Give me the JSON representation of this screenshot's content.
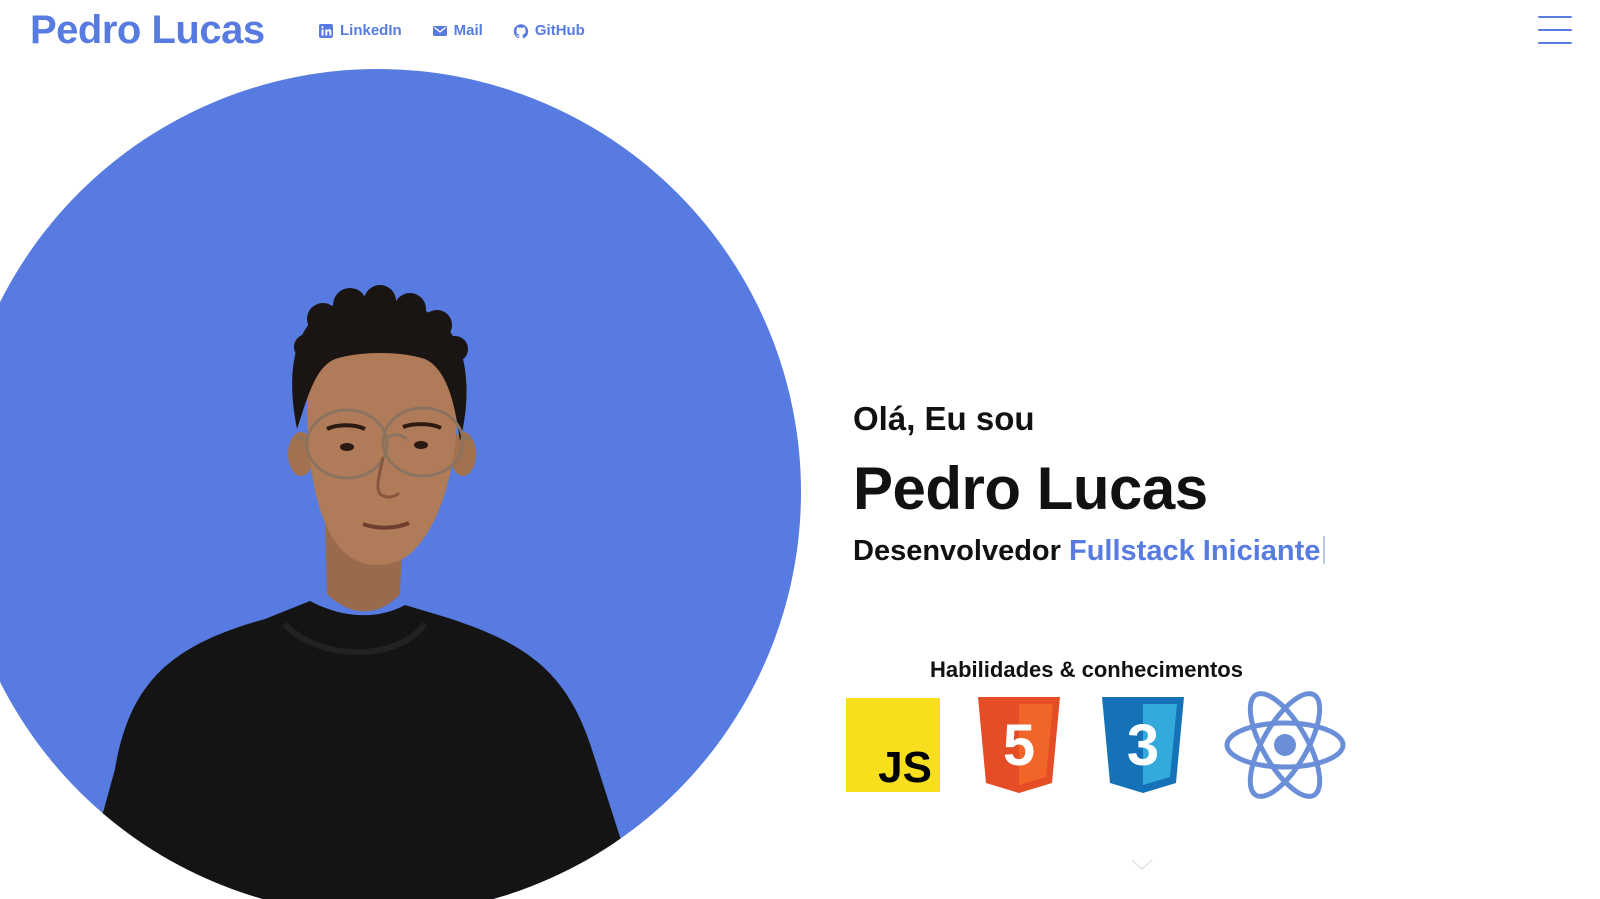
{
  "header": {
    "brand": "Pedro Lucas",
    "nav": [
      {
        "label": "LinkedIn",
        "icon": "linkedin-icon"
      },
      {
        "label": "Mail",
        "icon": "mail-icon"
      },
      {
        "label": "GitHub",
        "icon": "github-icon"
      }
    ],
    "menu_icon": "hamburger-menu-icon"
  },
  "hero": {
    "greeting": "Olá, Eu sou",
    "name": "Pedro Lucas",
    "role_prefix": "Desenvolvedor",
    "role_highlight": "Fullstack Iniciante",
    "photo_icon": "profile-photo"
  },
  "skills": {
    "title": "Habilidades & conhecimentos",
    "items": [
      {
        "name": "javascript-icon",
        "text": "JS"
      },
      {
        "name": "html5-icon",
        "text": "5"
      },
      {
        "name": "css3-icon",
        "text": "3"
      },
      {
        "name": "react-icon"
      }
    ]
  },
  "colors": {
    "accent": "#577be0",
    "text": "#111111",
    "background": "#ffffff",
    "js_yellow": "#f7df1e",
    "html_orange": "#e44d26",
    "css_blue": "#1572b6",
    "react_blue": "#6a8fd8"
  }
}
